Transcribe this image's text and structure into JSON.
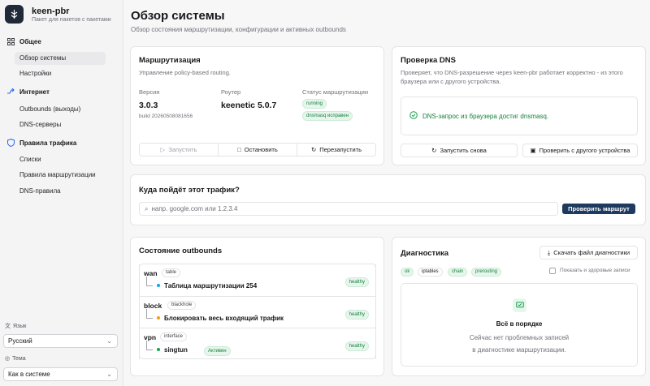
{
  "brand": {
    "name": "keen-pbr",
    "subtitle": "Пакет для пакетов с пакетами"
  },
  "nav": {
    "general": "Общее",
    "overview": "Обзор системы",
    "settings": "Настройки",
    "internet": "Интернет",
    "outbounds": "Outbounds (выходы)",
    "dns_servers": "DNS-серверы",
    "traffic_rules": "Правила трафика",
    "lists": "Списки",
    "routing_rules": "Правила маршрутизации",
    "dns_rules": "DNS-правила"
  },
  "sidebar_bottom": {
    "language_label": "Язык",
    "language_value": "Русский",
    "theme_label": "Тема",
    "theme_value": "Как в системе"
  },
  "page": {
    "title": "Обзор системы",
    "subtitle": "Обзор состояния маршрутизации, конфигурации и активных outbounds"
  },
  "routing": {
    "title": "Маршрутизация",
    "subtitle": "Управление policy-based routing.",
    "version_label": "Версия",
    "version": "3.0.3",
    "build": "build 20260508081656",
    "router_label": "Роутер",
    "router": "keenetic 5.0.7",
    "status_label": "Статус маршрутизации",
    "status_running": "running",
    "status_dnsmasq": "dnsmasq исправен",
    "start": "Запустить",
    "stop": "Остановить",
    "restart": "Перезапустить"
  },
  "dns_check": {
    "title": "Проверка DNS",
    "subtitle": "Проверяет, что DNS-разрешение через keen-pbr работает корректно - из этого браузера или с другого устройства.",
    "result": "DNS-запрос из браузера достиг dnsmasq.",
    "run_again": "Запустить снова",
    "other_device": "Проверить с другого устройства"
  },
  "route_check": {
    "title": "Куда пойдёт этот трафик?",
    "placeholder": "напр. google.com или 1.2.3.4",
    "button": "Проверить маршрут"
  },
  "outbounds": {
    "title": "Состояние outbounds",
    "items": [
      {
        "name": "wan",
        "tag": "table",
        "desc": "Таблица маршрутизации 254",
        "status": "healthy",
        "dot": "#0ea5e9",
        "extra": ""
      },
      {
        "name": "block",
        "tag": "blackhole",
        "desc": "Блокировать весь входящий трафик",
        "status": "healthy",
        "dot": "#f59e0b",
        "extra": ""
      },
      {
        "name": "vpn",
        "tag": "interface",
        "desc": "singtun",
        "status": "healthy",
        "dot": "#16a34a",
        "extra": "Активен"
      }
    ]
  },
  "diagnostics": {
    "title": "Диагностика",
    "download": "Скачать файл диагностики",
    "chips": [
      "ok",
      "iptables",
      "chain",
      "prerouting"
    ],
    "show_healthy": "Показать и здоровые записи",
    "empty_title": "Всё в порядке",
    "empty_line1": "Сейчас нет проблемных записей",
    "empty_line2": "в диагностике маршрутизации."
  }
}
